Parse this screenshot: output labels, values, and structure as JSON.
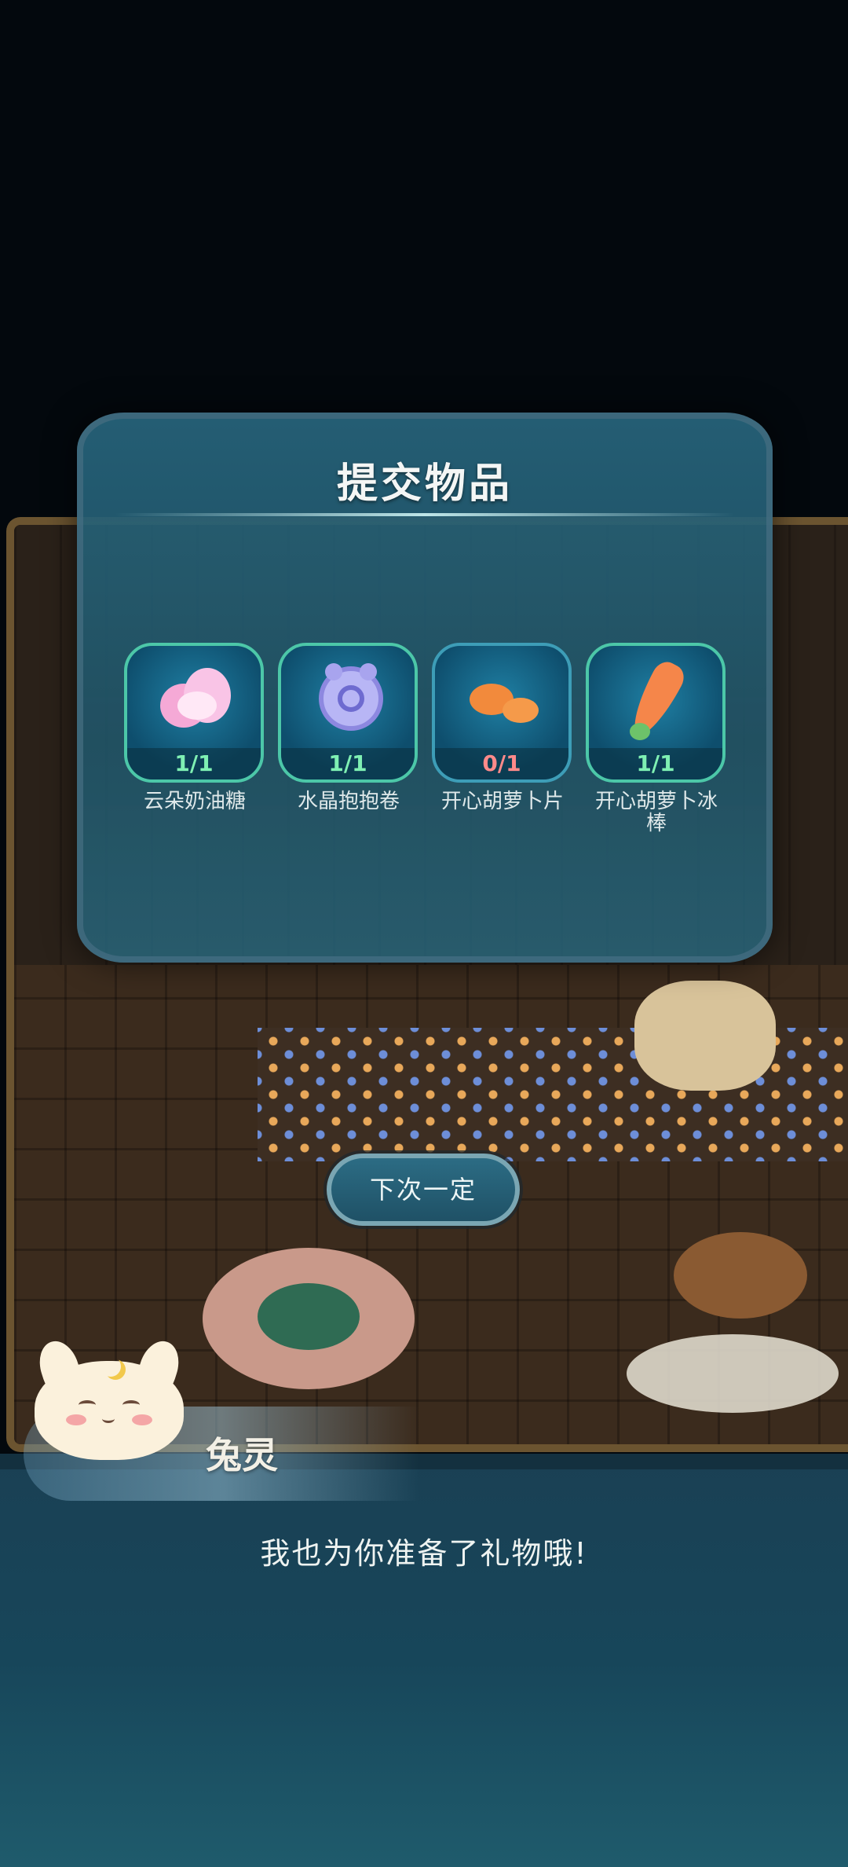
{
  "modal": {
    "title": "提交物品",
    "items": [
      {
        "name": "云朵奶油糖",
        "count": "1/1",
        "status": "complete",
        "icon": "cloud-candy-icon"
      },
      {
        "name": "水晶抱抱卷",
        "count": "1/1",
        "status": "complete",
        "icon": "crystal-roll-icon"
      },
      {
        "name": "开心胡萝卜片",
        "count": "0/1",
        "status": "incomplete",
        "icon": "carrot-chips-icon"
      },
      {
        "name": "开心胡萝卜冰棒",
        "count": "1/1",
        "status": "complete",
        "icon": "carrot-popsicle-icon"
      }
    ]
  },
  "next_button": {
    "label": "下次一定"
  },
  "dialog": {
    "speaker": "兔灵",
    "text": "我也为你准备了礼物哦!"
  },
  "colors": {
    "complete": "#7ff0b3",
    "incomplete": "#ff8a8a",
    "modal_bg": "#27657c"
  }
}
